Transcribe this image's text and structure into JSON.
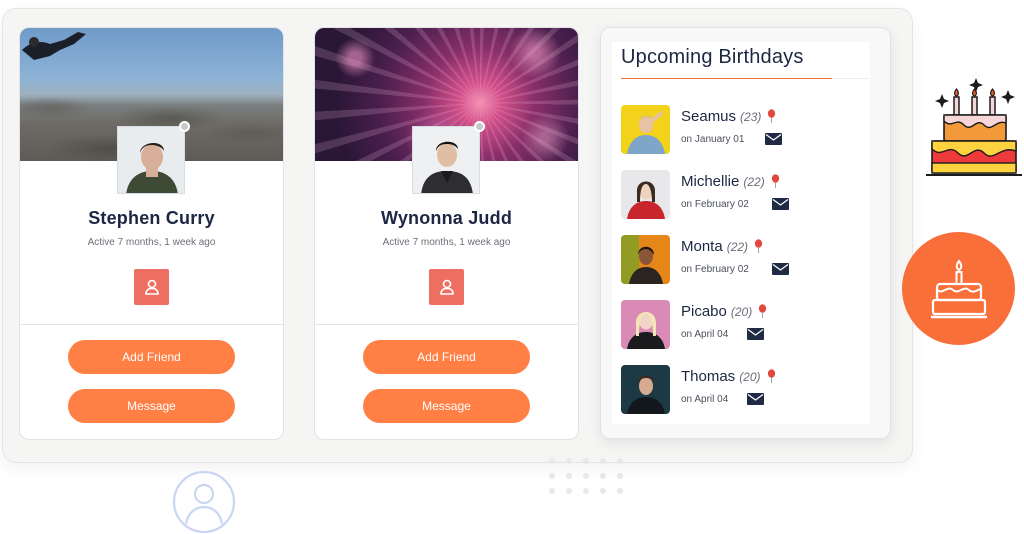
{
  "cards": [
    {
      "name": "Stephen Curry",
      "active": "Active 7 months, 1 week ago",
      "add_label": "Add Friend",
      "message_label": "Message"
    },
    {
      "name": "Wynonna Judd",
      "active": "Active 7 months, 1 week ago",
      "add_label": "Add Friend",
      "message_label": "Message"
    }
  ],
  "birthdays": {
    "title": "Upcoming Birthdays",
    "people": [
      {
        "name": "Seamus",
        "age": "(23)",
        "date": "on January 01"
      },
      {
        "name": "Michellie",
        "age": "(22)",
        "date": "on February 02"
      },
      {
        "name": "Monta",
        "age": "(22)",
        "date": "on February 02"
      },
      {
        "name": "Picabo",
        "age": "(20)",
        "date": "on April 04"
      },
      {
        "name": "Thomas",
        "age": "(20)",
        "date": "on April 04"
      }
    ]
  },
  "icons": {
    "profile": "user-icon",
    "balloon": "balloon-icon",
    "mail": "envelope-icon",
    "cake": "birthday-cake-icon"
  },
  "colors": {
    "accent": "#ff7f45",
    "profile_button": "#ec6f61",
    "circle": "#f96f3a",
    "text_dark": "#1c2743"
  }
}
